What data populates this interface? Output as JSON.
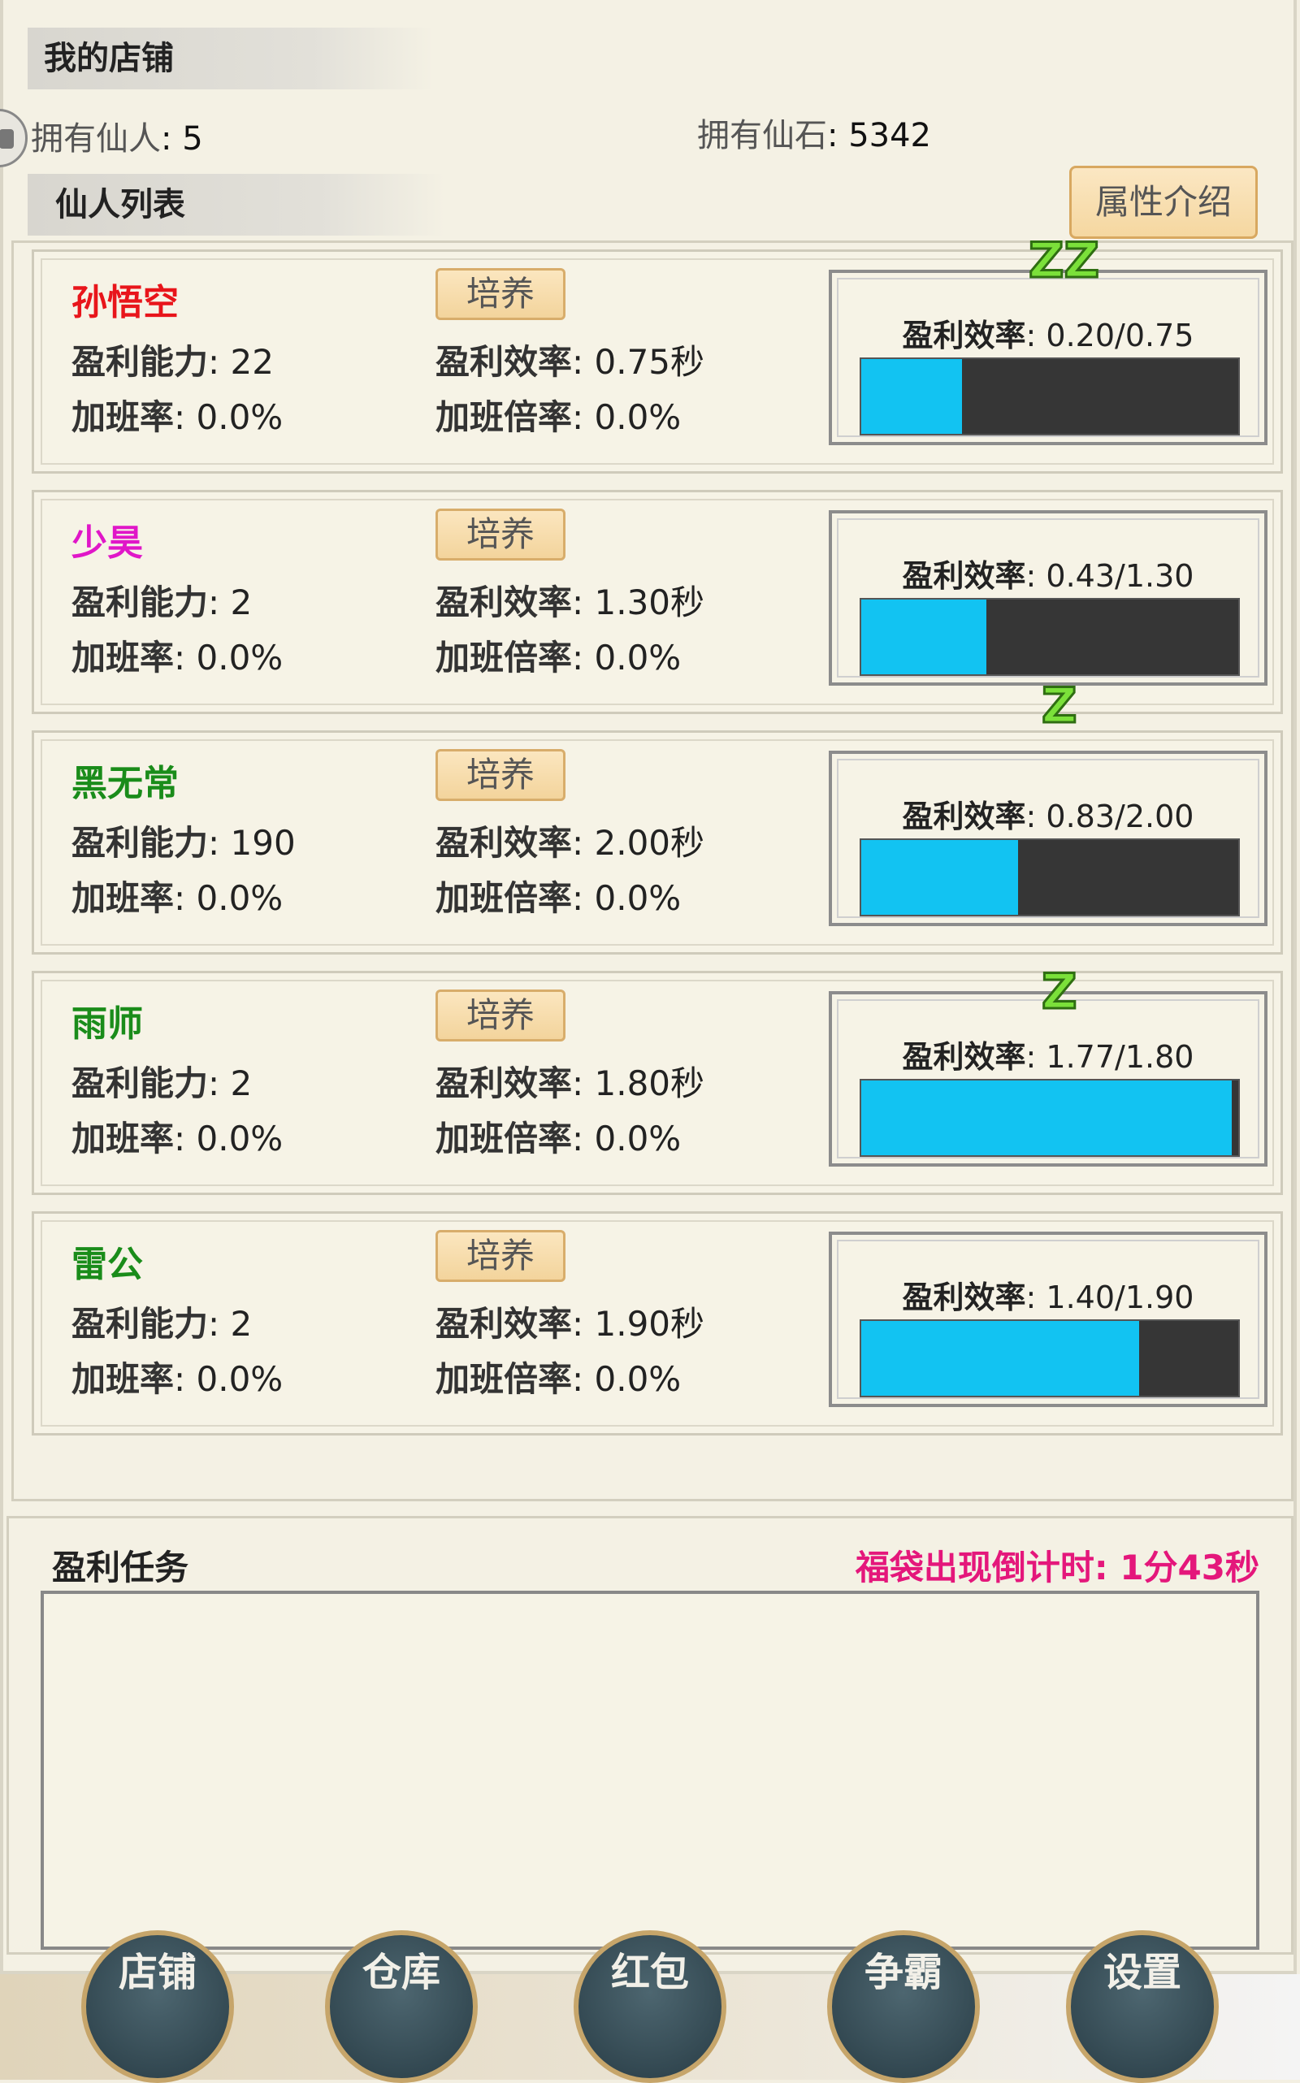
{
  "header": {
    "shop_title": "我的店铺",
    "immortals_label": "拥有仙人",
    "immortals_count": ": 5",
    "stones_label": "拥有仙石",
    "stones_count": ": 5342",
    "list_title": "仙人列表",
    "attr_button": "属性介绍"
  },
  "cards": [
    {
      "name": "孙悟空",
      "name_color": "#e8151b",
      "train": "培养",
      "ability_label": "盈利能力",
      "ability": ": 22",
      "efficiency_label": "盈利效率",
      "efficiency": ": 0.75秒",
      "overtime_label": "加班率",
      "overtime": ": 0.0%",
      "multiplier_label": "加班倍率",
      "multiplier": ": 0.0%",
      "eff_label": "盈利效率",
      "eff_progress": ": 0.20/0.75",
      "progress": 0.267,
      "sleep": "ZZ"
    },
    {
      "name": "少昊",
      "name_color": "#e016c8",
      "train": "培养",
      "ability_label": "盈利能力",
      "ability": ": 2",
      "efficiency_label": "盈利效率",
      "efficiency": ": 1.30秒",
      "overtime_label": "加班率",
      "overtime": ": 0.0%",
      "multiplier_label": "加班倍率",
      "multiplier": ": 0.0%",
      "eff_label": "盈利效率",
      "eff_progress": ": 0.43/1.30",
      "progress": 0.331,
      "sleep": "Z"
    },
    {
      "name": "黑无常",
      "name_color": "#1a8c1a",
      "train": "培养",
      "ability_label": "盈利能力",
      "ability": ": 190",
      "efficiency_label": "盈利效率",
      "efficiency": ": 2.00秒",
      "overtime_label": "加班率",
      "overtime": ": 0.0%",
      "multiplier_label": "加班倍率",
      "multiplier": ": 0.0%",
      "eff_label": "盈利效率",
      "eff_progress": ": 0.83/2.00",
      "progress": 0.415,
      "sleep": ""
    },
    {
      "name": "雨师",
      "name_color": "#1a8c1a",
      "train": "培养",
      "ability_label": "盈利能力",
      "ability": ": 2",
      "efficiency_label": "盈利效率",
      "efficiency": ": 1.80秒",
      "overtime_label": "加班率",
      "overtime": ": 0.0%",
      "multiplier_label": "加班倍率",
      "multiplier": ": 0.0%",
      "eff_label": "盈利效率",
      "eff_progress": ": 1.77/1.80",
      "progress": 0.983,
      "sleep": "Z"
    },
    {
      "name": "雷公",
      "name_color": "#1a8c1a",
      "train": "培养",
      "ability_label": "盈利能力",
      "ability": ": 2",
      "efficiency_label": "盈利效率",
      "efficiency": ": 1.90秒",
      "overtime_label": "加班率",
      "overtime": ": 0.0%",
      "multiplier_label": "加班倍率",
      "multiplier": ": 0.0%",
      "eff_label": "盈利效率",
      "eff_progress": ": 1.40/1.90",
      "progress": 0.737,
      "sleep": ""
    }
  ],
  "task": {
    "title": "盈利任务",
    "countdown": "福袋出现倒计时: 1分43秒"
  },
  "nav": [
    "店铺",
    "仓库",
    "红包",
    "争霸",
    "设置"
  ]
}
